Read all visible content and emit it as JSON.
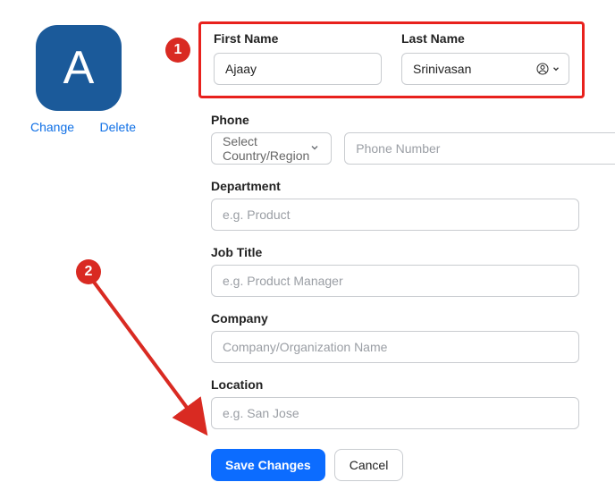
{
  "avatar": {
    "letter": "A",
    "change_label": "Change",
    "delete_label": "Delete"
  },
  "first_name": {
    "label": "First Name",
    "value": "Ajaay"
  },
  "last_name": {
    "label": "Last Name",
    "value": "Srinivasan"
  },
  "phone": {
    "label": "Phone",
    "country_placeholder": "Select Country/Region",
    "number_placeholder": "Phone Number"
  },
  "department": {
    "label": "Department",
    "placeholder": "e.g. Product"
  },
  "job_title": {
    "label": "Job Title",
    "placeholder": "e.g. Product Manager"
  },
  "company": {
    "label": "Company",
    "placeholder": "Company/Organization Name"
  },
  "location": {
    "label": "Location",
    "placeholder": "e.g. San Jose"
  },
  "buttons": {
    "save": "Save Changes",
    "cancel": "Cancel"
  },
  "annotations": {
    "badge1": "1",
    "badge2": "2"
  }
}
